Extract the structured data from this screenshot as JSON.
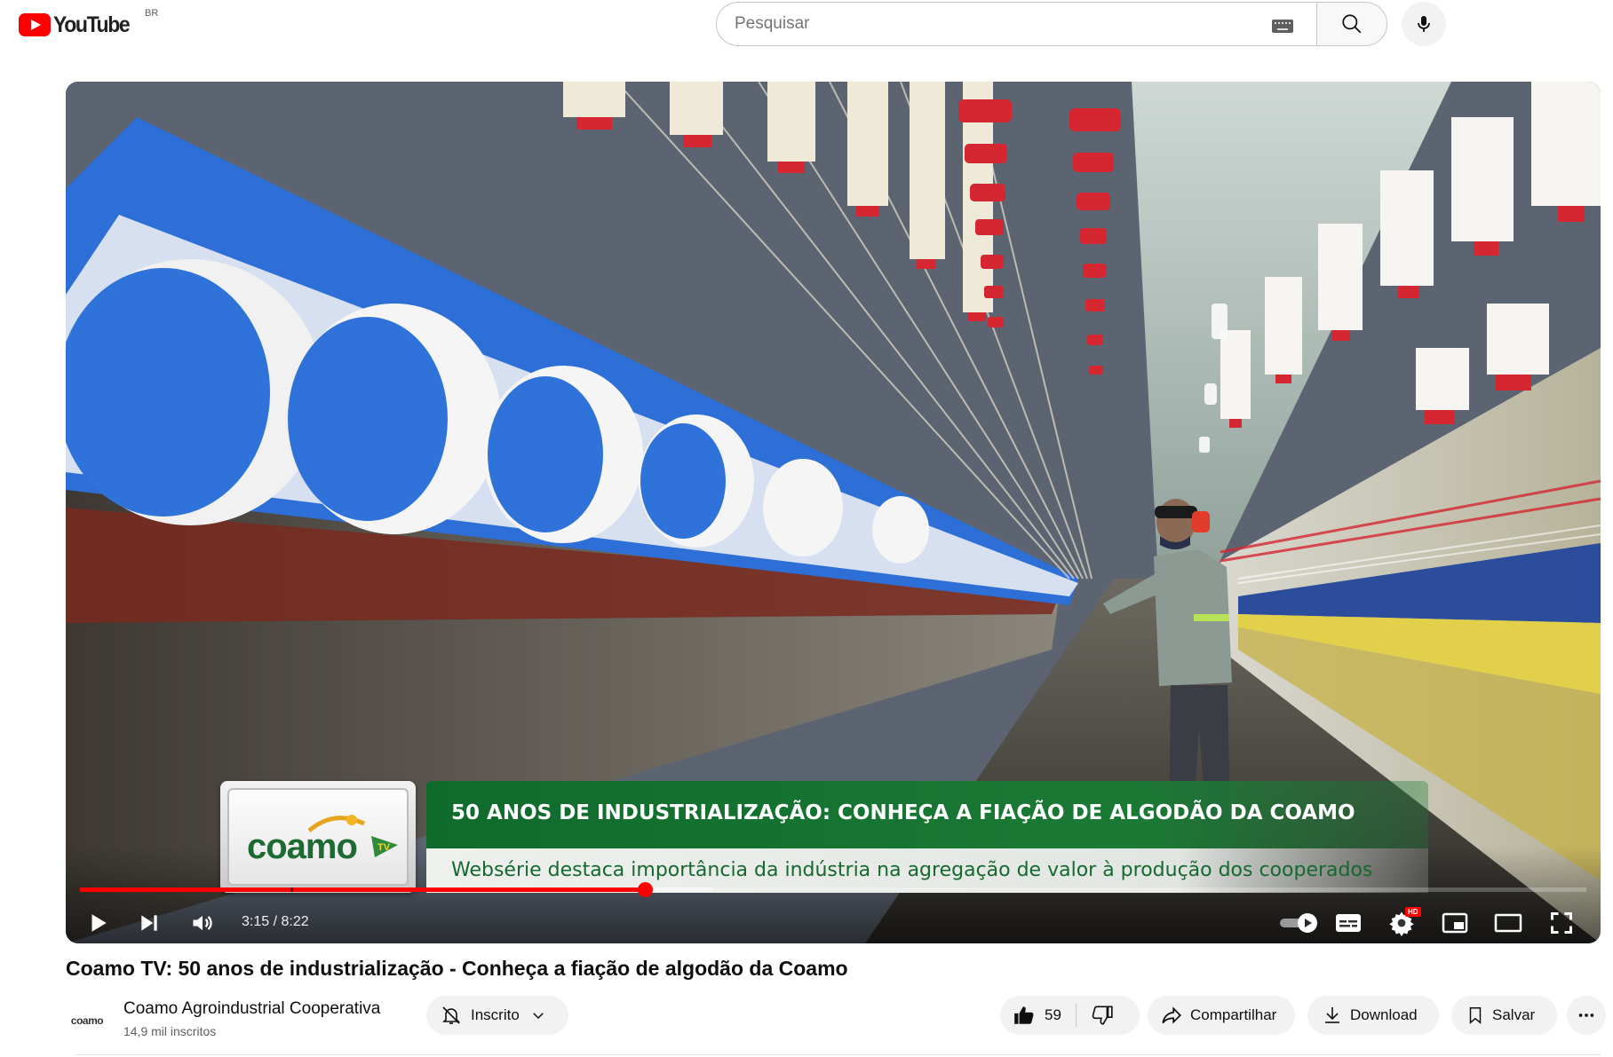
{
  "masthead": {
    "logo_text": "YouTube",
    "country_code": "BR",
    "search_placeholder": "Pesquisar",
    "icons": [
      "keyboard-icon",
      "search-icon",
      "microphone-icon"
    ]
  },
  "player": {
    "time_current": "3:15",
    "time_separator": " / ",
    "time_duration": "8:22",
    "progress_played_fraction": 0.375,
    "progress_buffered_fraction": 0.42,
    "chapter_mark_fraction": 0.14,
    "overlay": {
      "logo_text": "coamo",
      "title": "50 ANOS DE INDUSTRIALIZAÇÃO: CONHEÇA A FIAÇÃO DE ALGODÃO DA COAMO",
      "subtitle": "Websérie destaca importância da indústria na agregação de valor à produção dos cooperados"
    },
    "hd_badge": "HD",
    "accent_color": "#ff0000"
  },
  "video": {
    "title": "Coamo TV: 50 anos de industrialização - Conheça a fiação de algodão da Coamo"
  },
  "channel": {
    "avatar_text": "coamo",
    "name": "Coamo Agroindustrial Cooperativa",
    "subscribers": "14,9 mil inscritos",
    "subscribe_label": "Inscrito"
  },
  "actions": {
    "like_count": "59",
    "share_label": "Compartilhar",
    "download_label": "Download",
    "save_label": "Salvar"
  }
}
